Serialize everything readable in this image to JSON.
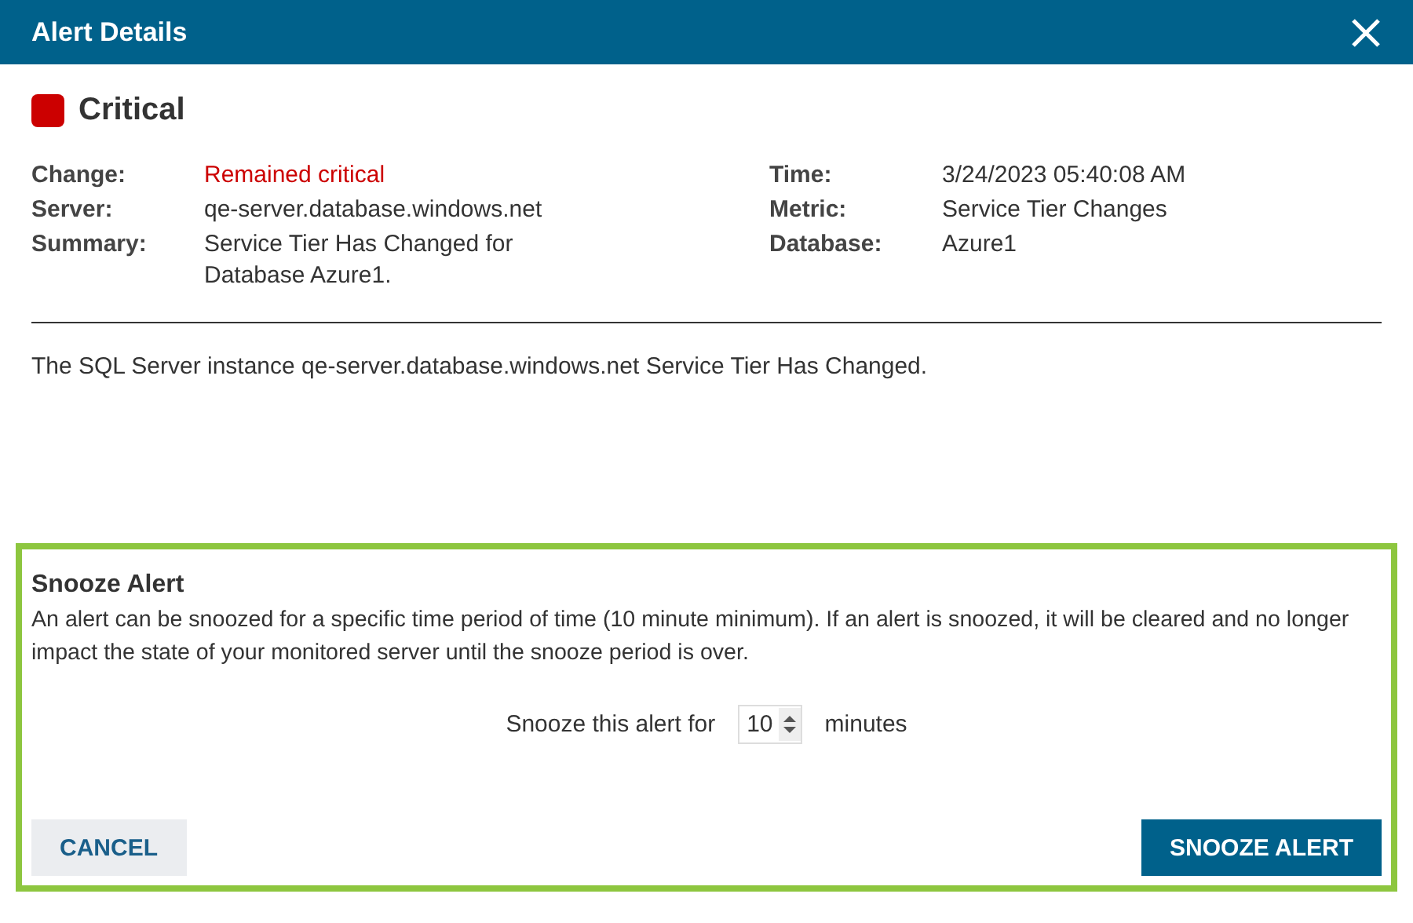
{
  "window": {
    "title": "Alert Details"
  },
  "severity": {
    "label": "Critical",
    "color": "#cc0000"
  },
  "details_left": [
    {
      "label": "Change:",
      "value": "Remained critical",
      "color": "#cc0000"
    },
    {
      "label": "Server:",
      "value": "qe-server.database.windows.net"
    },
    {
      "label": "Summary:",
      "value": "Service Tier Has Changed for Database Azure1."
    }
  ],
  "details_right": [
    {
      "label": "Time:",
      "value": "3/24/2023 05:40:08 AM"
    },
    {
      "label": "Metric:",
      "value": "Service Tier Changes"
    },
    {
      "label": "Database:",
      "value": "Azure1"
    }
  ],
  "description": "The SQL Server instance qe-server.database.windows.net Service Tier Has Changed.",
  "snooze": {
    "title": "Snooze Alert",
    "text": "An alert can be snoozed for a specific time period of time (10 minute minimum). If an alert is snoozed, it will be cleared and no longer impact the state of your monitored server until the snooze period is over.",
    "prompt": "Snooze this alert for",
    "value": "10",
    "unit": "minutes"
  },
  "buttons": [
    {
      "label": "CANCEL",
      "kind": "secondary"
    },
    {
      "label": "SNOOZE ALERT",
      "kind": "primary"
    }
  ]
}
